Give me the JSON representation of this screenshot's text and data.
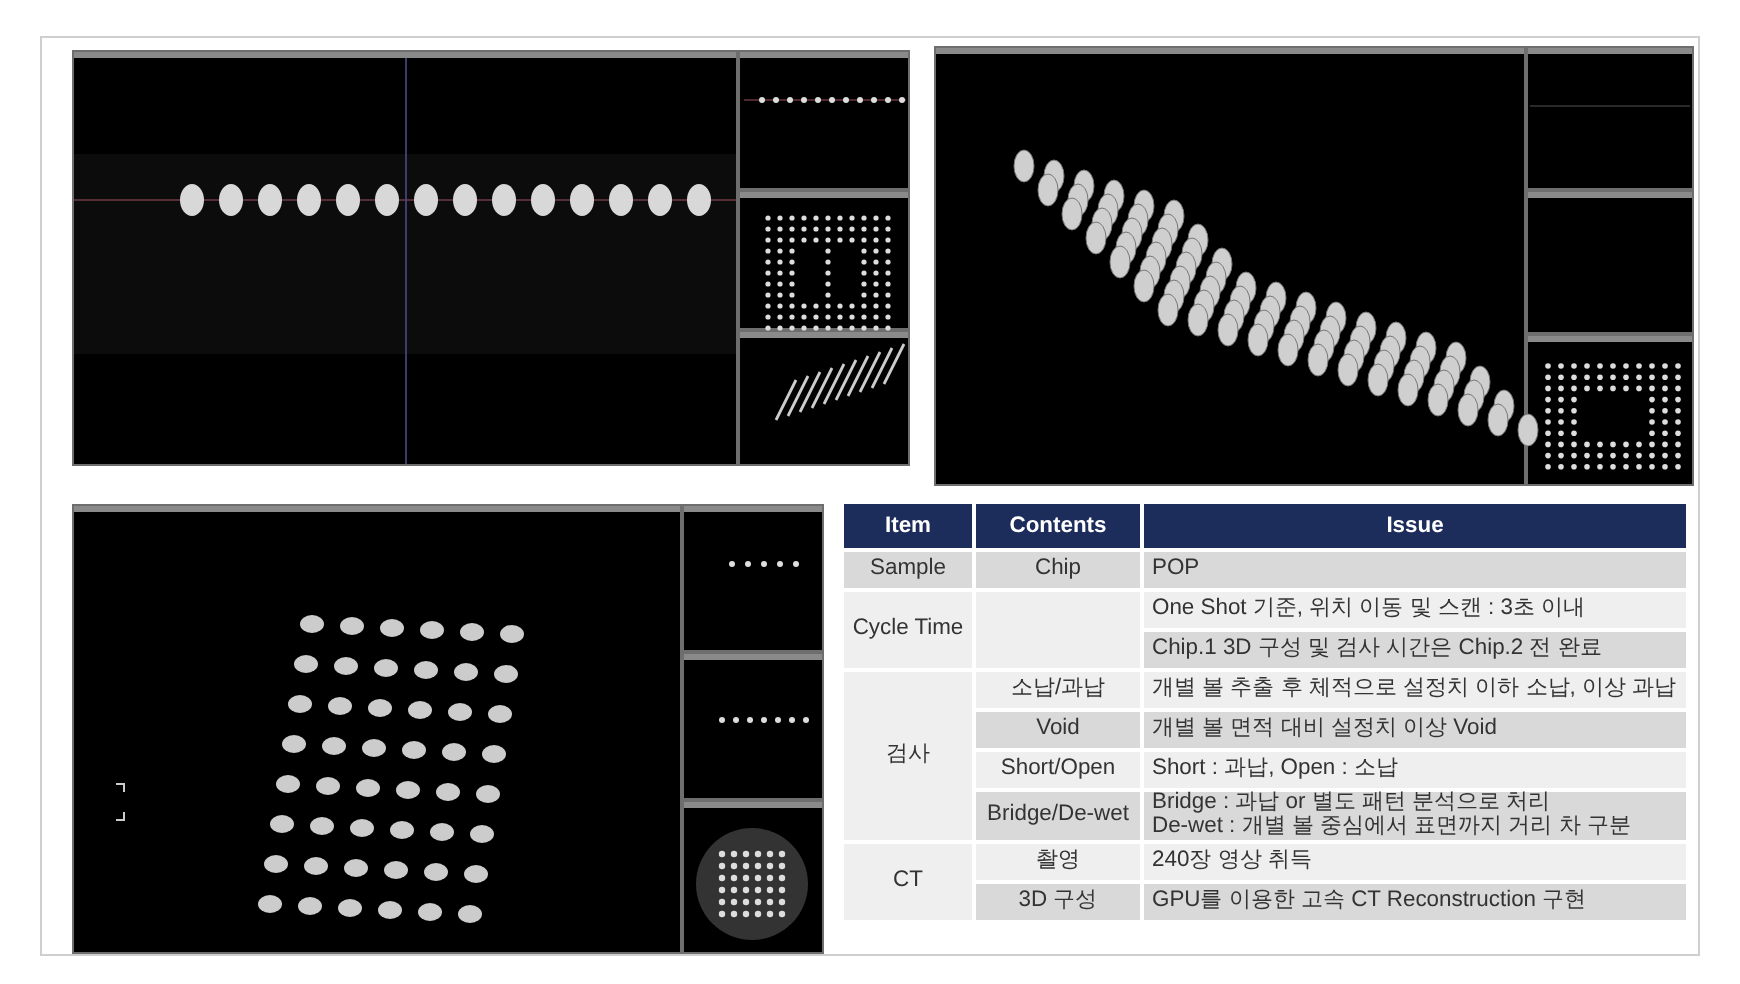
{
  "figures": [
    {
      "kind": "side_profile"
    },
    {
      "kind": "render_3d"
    },
    {
      "kind": "top_view"
    }
  ],
  "table": {
    "columns": [
      "Item",
      "Contents",
      "Issue"
    ],
    "groups": [
      {
        "item": "Sample",
        "entries": [
          {
            "contents": "Chip",
            "issue": [
              "POP"
            ]
          }
        ]
      },
      {
        "item": "Cycle Time",
        "entries": [
          {
            "issue": [
              "One Shot 기준, 위치 이동 및 스캔 : 3초 이내"
            ]
          },
          {
            "issue": [
              "Chip.1 3D 구성 및 검사 시간은 Chip.2 전 완료"
            ]
          }
        ]
      },
      {
        "item": "검사",
        "entries": [
          {
            "contents": "소납/과납",
            "issue": [
              "개별 볼 추출 후 체적으로 설정치 이하 소납, 이상 과납"
            ]
          },
          {
            "contents": "Void",
            "issue": [
              "개별 볼 면적 대비 설정치 이상 Void"
            ]
          },
          {
            "contents": "Short/Open",
            "issue": [
              "Short : 과납, Open : 소납"
            ]
          },
          {
            "contents": "Bridge/De-wet",
            "issue": [
              "Bridge : 과납 or 별도 패턴 분석으로 처리",
              "De-wet : 개별 볼 중심에서 표면까지 거리 차 구분"
            ]
          }
        ]
      },
      {
        "item": "CT",
        "entries": [
          {
            "contents": "촬영",
            "issue": [
              "240장 영상 취득"
            ]
          },
          {
            "contents": "3D 구성",
            "issue": [
              "GPU를 이용한 고속 CT Reconstruction 구현"
            ]
          }
        ]
      }
    ]
  }
}
